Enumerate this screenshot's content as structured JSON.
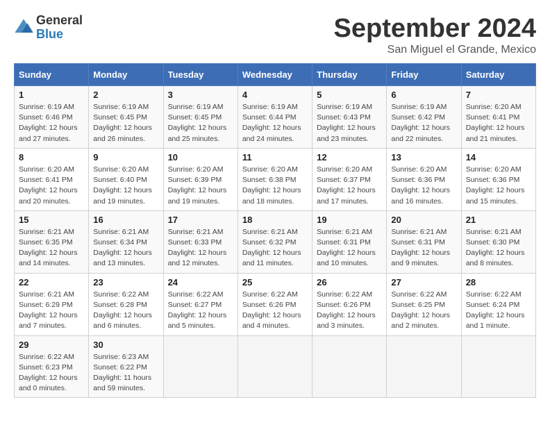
{
  "header": {
    "logo_line1": "General",
    "logo_line2": "Blue",
    "month_title": "September 2024",
    "location": "San Miguel el Grande, Mexico"
  },
  "weekdays": [
    "Sunday",
    "Monday",
    "Tuesday",
    "Wednesday",
    "Thursday",
    "Friday",
    "Saturday"
  ],
  "weeks": [
    [
      {
        "day": "1",
        "info": "Sunrise: 6:19 AM\nSunset: 6:46 PM\nDaylight: 12 hours\nand 27 minutes."
      },
      {
        "day": "2",
        "info": "Sunrise: 6:19 AM\nSunset: 6:45 PM\nDaylight: 12 hours\nand 26 minutes."
      },
      {
        "day": "3",
        "info": "Sunrise: 6:19 AM\nSunset: 6:45 PM\nDaylight: 12 hours\nand 25 minutes."
      },
      {
        "day": "4",
        "info": "Sunrise: 6:19 AM\nSunset: 6:44 PM\nDaylight: 12 hours\nand 24 minutes."
      },
      {
        "day": "5",
        "info": "Sunrise: 6:19 AM\nSunset: 6:43 PM\nDaylight: 12 hours\nand 23 minutes."
      },
      {
        "day": "6",
        "info": "Sunrise: 6:19 AM\nSunset: 6:42 PM\nDaylight: 12 hours\nand 22 minutes."
      },
      {
        "day": "7",
        "info": "Sunrise: 6:20 AM\nSunset: 6:41 PM\nDaylight: 12 hours\nand 21 minutes."
      }
    ],
    [
      {
        "day": "8",
        "info": "Sunrise: 6:20 AM\nSunset: 6:41 PM\nDaylight: 12 hours\nand 20 minutes."
      },
      {
        "day": "9",
        "info": "Sunrise: 6:20 AM\nSunset: 6:40 PM\nDaylight: 12 hours\nand 19 minutes."
      },
      {
        "day": "10",
        "info": "Sunrise: 6:20 AM\nSunset: 6:39 PM\nDaylight: 12 hours\nand 19 minutes."
      },
      {
        "day": "11",
        "info": "Sunrise: 6:20 AM\nSunset: 6:38 PM\nDaylight: 12 hours\nand 18 minutes."
      },
      {
        "day": "12",
        "info": "Sunrise: 6:20 AM\nSunset: 6:37 PM\nDaylight: 12 hours\nand 17 minutes."
      },
      {
        "day": "13",
        "info": "Sunrise: 6:20 AM\nSunset: 6:36 PM\nDaylight: 12 hours\nand 16 minutes."
      },
      {
        "day": "14",
        "info": "Sunrise: 6:20 AM\nSunset: 6:36 PM\nDaylight: 12 hours\nand 15 minutes."
      }
    ],
    [
      {
        "day": "15",
        "info": "Sunrise: 6:21 AM\nSunset: 6:35 PM\nDaylight: 12 hours\nand 14 minutes."
      },
      {
        "day": "16",
        "info": "Sunrise: 6:21 AM\nSunset: 6:34 PM\nDaylight: 12 hours\nand 13 minutes."
      },
      {
        "day": "17",
        "info": "Sunrise: 6:21 AM\nSunset: 6:33 PM\nDaylight: 12 hours\nand 12 minutes."
      },
      {
        "day": "18",
        "info": "Sunrise: 6:21 AM\nSunset: 6:32 PM\nDaylight: 12 hours\nand 11 minutes."
      },
      {
        "day": "19",
        "info": "Sunrise: 6:21 AM\nSunset: 6:31 PM\nDaylight: 12 hours\nand 10 minutes."
      },
      {
        "day": "20",
        "info": "Sunrise: 6:21 AM\nSunset: 6:31 PM\nDaylight: 12 hours\nand 9 minutes."
      },
      {
        "day": "21",
        "info": "Sunrise: 6:21 AM\nSunset: 6:30 PM\nDaylight: 12 hours\nand 8 minutes."
      }
    ],
    [
      {
        "day": "22",
        "info": "Sunrise: 6:21 AM\nSunset: 6:29 PM\nDaylight: 12 hours\nand 7 minutes."
      },
      {
        "day": "23",
        "info": "Sunrise: 6:22 AM\nSunset: 6:28 PM\nDaylight: 12 hours\nand 6 minutes."
      },
      {
        "day": "24",
        "info": "Sunrise: 6:22 AM\nSunset: 6:27 PM\nDaylight: 12 hours\nand 5 minutes."
      },
      {
        "day": "25",
        "info": "Sunrise: 6:22 AM\nSunset: 6:26 PM\nDaylight: 12 hours\nand 4 minutes."
      },
      {
        "day": "26",
        "info": "Sunrise: 6:22 AM\nSunset: 6:26 PM\nDaylight: 12 hours\nand 3 minutes."
      },
      {
        "day": "27",
        "info": "Sunrise: 6:22 AM\nSunset: 6:25 PM\nDaylight: 12 hours\nand 2 minutes."
      },
      {
        "day": "28",
        "info": "Sunrise: 6:22 AM\nSunset: 6:24 PM\nDaylight: 12 hours\nand 1 minute."
      }
    ],
    [
      {
        "day": "29",
        "info": "Sunrise: 6:22 AM\nSunset: 6:23 PM\nDaylight: 12 hours\nand 0 minutes."
      },
      {
        "day": "30",
        "info": "Sunrise: 6:23 AM\nSunset: 6:22 PM\nDaylight: 11 hours\nand 59 minutes."
      },
      {
        "day": "",
        "info": ""
      },
      {
        "day": "",
        "info": ""
      },
      {
        "day": "",
        "info": ""
      },
      {
        "day": "",
        "info": ""
      },
      {
        "day": "",
        "info": ""
      }
    ]
  ]
}
